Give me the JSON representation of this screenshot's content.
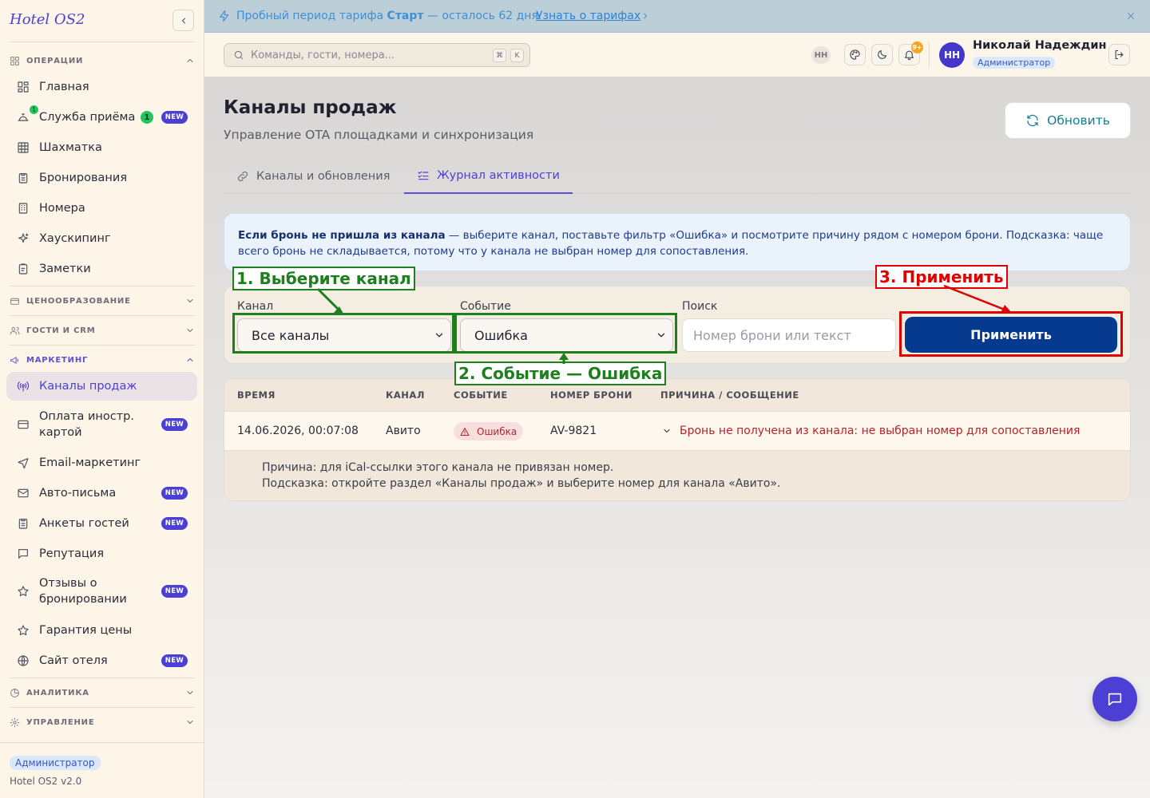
{
  "brand": "Hotel OS2",
  "sidebar": {
    "sections": [
      {
        "label": "ОПЕРАЦИИ",
        "icon": "grid-icon",
        "expanded": true
      },
      {
        "label": "ЦЕНООБРАЗОВАНИЕ",
        "icon": "wallet-icon",
        "expanded": false
      },
      {
        "label": "ГОСТИ И CRM",
        "icon": "users-icon",
        "expanded": false
      },
      {
        "label": "МАРКЕТИНГ",
        "icon": "megaphone-icon",
        "expanded": true
      },
      {
        "label": "АНАЛИТИКА",
        "icon": "chart-icon",
        "expanded": false
      },
      {
        "label": "УПРАВЛЕНИЕ",
        "icon": "gear-icon",
        "expanded": false
      }
    ],
    "items": [
      {
        "label": "Главная",
        "icon": "dashboard-icon"
      },
      {
        "label": "Служба приёма",
        "icon": "bell-desk-icon",
        "count": "1",
        "badge": "NEW",
        "dot": "1"
      },
      {
        "label": "Шахматка",
        "icon": "table-icon"
      },
      {
        "label": "Бронирования",
        "icon": "clipboard-icon"
      },
      {
        "label": "Номера",
        "icon": "building-icon"
      },
      {
        "label": "Хаускипинг",
        "icon": "sparkles-icon"
      },
      {
        "label": "Заметки",
        "icon": "note-icon"
      },
      {
        "label": "Каналы продаж",
        "icon": "radio-icon",
        "active": true
      },
      {
        "label": "Оплата иностр. картой",
        "icon": "card-icon",
        "badge": "NEW"
      },
      {
        "label": "Email-маркетинг",
        "icon": "send-icon"
      },
      {
        "label": "Авто-письма",
        "icon": "mail-icon",
        "badge": "NEW"
      },
      {
        "label": "Анкеты гостей",
        "icon": "clipboard-list-icon",
        "badge": "NEW"
      },
      {
        "label": "Репутация",
        "icon": "message-icon"
      },
      {
        "label": "Отзывы о бронировании",
        "icon": "star-icon",
        "badge": "NEW"
      },
      {
        "label": "Гарантия цены",
        "icon": "star-outline-icon"
      },
      {
        "label": "Сайт отеля",
        "icon": "globe-icon",
        "badge": "NEW"
      }
    ],
    "footer_role": "Администратор",
    "footer_version": "Hotel OS2 v2.0"
  },
  "banner": {
    "text_prefix": "Пробный период тарифа ",
    "plan": "Старт",
    "text_suffix": " — осталось 62 дня.",
    "link": "Узнать о тарифах"
  },
  "topbar": {
    "search_placeholder": "Команды, гости, номера...",
    "kbd1": "⌘",
    "kbd2": "K",
    "small_initials": "НН",
    "bell_badge": "9+",
    "user_initials": "НН",
    "user_name": "Николай Надеждин",
    "user_role": "Администратор"
  },
  "page": {
    "title": "Каналы продаж",
    "subtitle": "Управление OTA площадками и синхронизация",
    "refresh_label": "Обновить",
    "tabs": [
      {
        "label": "Каналы и обновления",
        "icon": "link-icon",
        "active": false
      },
      {
        "label": "Журнал активности",
        "icon": "list-check-icon",
        "active": true
      }
    ],
    "info_bold": "Если бронь не пришла из канала",
    "info_rest": " — выберите канал, поставьте фильтр «Ошибка» и посмотрите причину рядом с номером брони. Подсказка: чаще всего бронь не складывается, потому что у канала не выбран номер для сопоставления.",
    "filters": {
      "channel_label": "Канал",
      "channel_value": "Все каналы",
      "event_label": "Событие",
      "event_value": "Ошибка",
      "search_label": "Поиск",
      "search_placeholder": "Номер брони или текст",
      "apply_label": "Применить"
    },
    "table": {
      "columns": [
        "ВРЕМЯ",
        "КАНАЛ",
        "СОБЫТИЕ",
        "НОМЕР БРОНИ",
        "ПРИЧИНА / СООБЩЕНИЕ"
      ],
      "rows": [
        {
          "time": "14.06.2026, 00:07:08",
          "channel": "Авито",
          "event": "Ошибка",
          "booking": "AV-9821",
          "message": "Бронь не получена из канала: не выбран номер для сопоставления",
          "detail_1": "Причина: для iCal-ссылки этого канала не привязан номер.",
          "detail_2": "Подсказка: откройте раздел «Каналы продаж» и выберите номер для канала «Авито»."
        }
      ]
    }
  },
  "annotations": {
    "step1": "1. Выберите канал",
    "step2": "2. Событие — Ошибка",
    "step3": "3. Применить"
  },
  "colors": {
    "accent": "#4b3fd4",
    "apply_button": "#053a8e",
    "error": "#b4232c",
    "annotation_green": "#1e7f1e",
    "annotation_red": "#e00000"
  }
}
